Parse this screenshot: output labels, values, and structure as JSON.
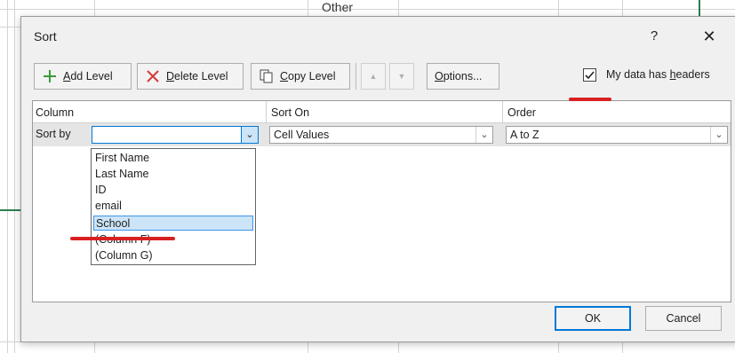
{
  "background": {
    "cell_text": "Other"
  },
  "dialog": {
    "title": "Sort",
    "help": "?",
    "close": "✕"
  },
  "toolbar": {
    "add_level": {
      "accel": "A",
      "rest": "dd Level"
    },
    "delete_level": {
      "accel": "D",
      "rest": "elete Level"
    },
    "copy_level": {
      "accel": "C",
      "rest": "opy Level"
    },
    "move_up": "▲",
    "move_down": "▼",
    "options": {
      "accel": "O",
      "rest": "ptions..."
    },
    "has_headers": {
      "checked": true,
      "prefix": "My data has ",
      "accel": "h",
      "rest": "eaders"
    }
  },
  "grid": {
    "headers": [
      "Column",
      "Sort On",
      "Order"
    ],
    "row": {
      "label": "Sort by",
      "column_value": "",
      "sort_on": "Cell Values",
      "order": "A to Z"
    }
  },
  "dropdown": {
    "items": [
      "First Name",
      "Last Name",
      "ID",
      "email",
      "School",
      "(Column F)",
      "(Column G)"
    ],
    "selected_index": 4
  },
  "buttons": {
    "ok": "OK",
    "cancel": "Cancel"
  },
  "colors": {
    "accent": "#0078d7",
    "selection": "#cce4f7",
    "annotation": "#d92020"
  }
}
